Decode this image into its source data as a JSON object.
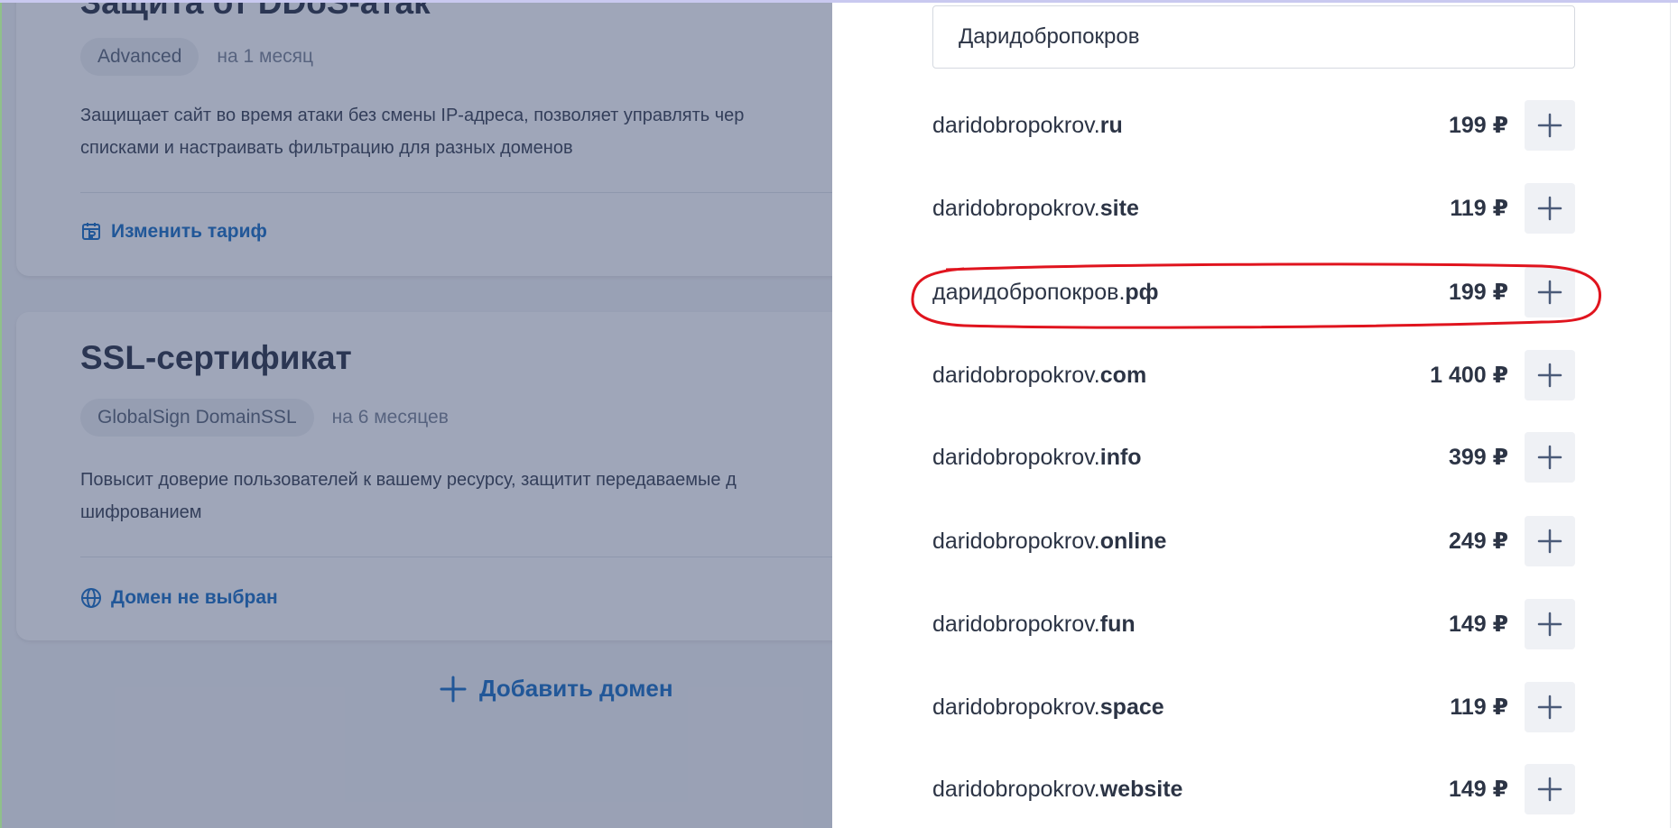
{
  "background": {
    "ddos_card": {
      "title": "Защита от DDoS-атак",
      "plan": "Advanced",
      "period": "на 1 месяц",
      "description_line1": "Защищает сайт во время атаки без смены IP-адреса, позволяет управлять чер",
      "description_line2": "списками и настраивать фильтрацию для разных доменов",
      "action_label": "Изменить тариф"
    },
    "ssl_card": {
      "title": "SSL-сертификат",
      "plan": "GlobalSign DomainSSL",
      "period": "на 6 месяцев",
      "description_line1": "Повысит доверие пользователей к вашему ресурсу, защитит передаваемые д",
      "description_line2": "шифрованием",
      "action_label": "Домен не выбран"
    },
    "add_domain_label": "Добавить домен"
  },
  "panel": {
    "search_value": "Даридобропокров",
    "domains": [
      {
        "name": "daridobropokrov.",
        "zone": "ru",
        "price": "199 ₽"
      },
      {
        "name": "daridobropokrov.",
        "zone": "site",
        "price": "119 ₽"
      },
      {
        "name": "даридобропокров.",
        "zone": "рф",
        "price": "199 ₽"
      },
      {
        "name": "daridobropokrov.",
        "zone": "com",
        "price": "1 400 ₽"
      },
      {
        "name": "daridobropokrov.",
        "zone": "info",
        "price": "399 ₽"
      },
      {
        "name": "daridobropokrov.",
        "zone": "online",
        "price": "249 ₽"
      },
      {
        "name": "daridobropokrov.",
        "zone": "fun",
        "price": "149 ₽"
      },
      {
        "name": "daridobropokrov.",
        "zone": "space",
        "price": "119 ₽"
      },
      {
        "name": "daridobropokrov.",
        "zone": "website",
        "price": "149 ₽"
      }
    ]
  },
  "colors": {
    "accent": "#1a6fc4",
    "text": "#2c3445",
    "overlay": "#2b3a63",
    "annotation": "#e0141e"
  },
  "icons": [
    "tariff-icon",
    "globe-icon",
    "plus-icon"
  ]
}
